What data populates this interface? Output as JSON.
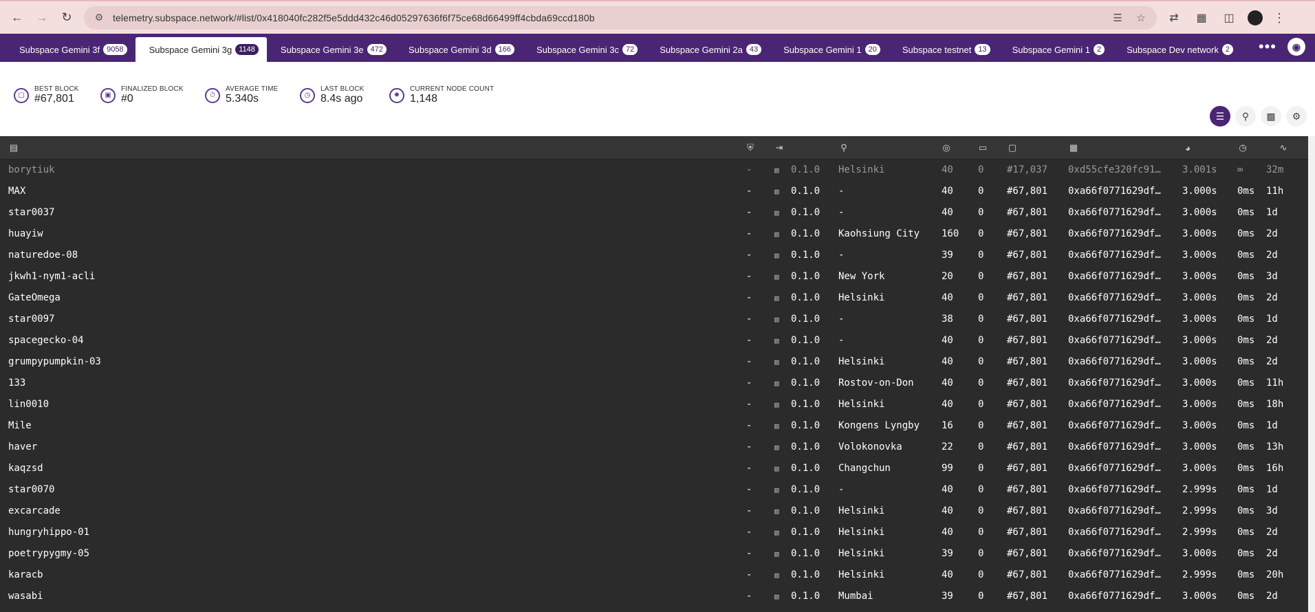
{
  "browser": {
    "url": "telemetry.subspace.network/#list/0x418040fc282f5e5ddd432c46d05297636f6f75ce68d66499ff4cbda69ccd180b"
  },
  "tabs": [
    {
      "label": "Subspace Gemini 3f",
      "count": "9058",
      "active": false
    },
    {
      "label": "Subspace Gemini 3g",
      "count": "1148",
      "active": true
    },
    {
      "label": "Subspace Gemini 3e",
      "count": "472",
      "active": false
    },
    {
      "label": "Subspace Gemini 3d",
      "count": "166",
      "active": false
    },
    {
      "label": "Subspace Gemini 3c",
      "count": "72",
      "active": false
    },
    {
      "label": "Subspace Gemini 2a",
      "count": "43",
      "active": false
    },
    {
      "label": "Subspace Gemini 1",
      "count": "20",
      "active": false
    },
    {
      "label": "Subspace testnet",
      "count": "13",
      "active": false
    },
    {
      "label": "Subspace Gemini 1",
      "count": "2",
      "active": false
    },
    {
      "label": "Subspace Dev network",
      "count": "2",
      "active": false
    }
  ],
  "stats": {
    "best_block": {
      "label": "Best Block",
      "value": "#67,801"
    },
    "finalized_block": {
      "label": "Finalized Block",
      "value": "#0"
    },
    "average_time": {
      "label": "Average Time",
      "value": "5.340s"
    },
    "last_block": {
      "label": "Last Block",
      "value": "8.4s ago"
    },
    "node_count": {
      "label": "Current Node Count",
      "value": "1,148"
    }
  },
  "nodes": [
    {
      "name": "borytiuk",
      "validator": "-",
      "version": "0.1.0",
      "location": "Helsinki",
      "peers": "40",
      "txs": "0",
      "block": "#17,037",
      "hash": "0xd55cfe320fc91…",
      "time": "3.001s",
      "propagation": "∞",
      "uptime": "32m",
      "stale": true
    },
    {
      "name": "MAX",
      "validator": "-",
      "version": "0.1.0",
      "location": "-",
      "peers": "40",
      "txs": "0",
      "block": "#67,801",
      "hash": "0xa66f0771629df…",
      "time": "3.000s",
      "propagation": "0ms",
      "uptime": "11h"
    },
    {
      "name": "star0037",
      "validator": "-",
      "version": "0.1.0",
      "location": "-",
      "peers": "40",
      "txs": "0",
      "block": "#67,801",
      "hash": "0xa66f0771629df…",
      "time": "3.000s",
      "propagation": "0ms",
      "uptime": "1d"
    },
    {
      "name": "huayiw",
      "validator": "-",
      "version": "0.1.0",
      "location": "Kaohsiung City",
      "peers": "160",
      "txs": "0",
      "block": "#67,801",
      "hash": "0xa66f0771629df…",
      "time": "3.000s",
      "propagation": "0ms",
      "uptime": "2d"
    },
    {
      "name": "naturedoe-08",
      "validator": "-",
      "version": "0.1.0",
      "location": "-",
      "peers": "39",
      "txs": "0",
      "block": "#67,801",
      "hash": "0xa66f0771629df…",
      "time": "3.000s",
      "propagation": "0ms",
      "uptime": "2d"
    },
    {
      "name": "jkwh1-nym1-acli",
      "validator": "-",
      "version": "0.1.0",
      "location": "New York",
      "peers": "20",
      "txs": "0",
      "block": "#67,801",
      "hash": "0xa66f0771629df…",
      "time": "3.000s",
      "propagation": "0ms",
      "uptime": "3d"
    },
    {
      "name": "GateOmega",
      "validator": "-",
      "version": "0.1.0",
      "location": "Helsinki",
      "peers": "40",
      "txs": "0",
      "block": "#67,801",
      "hash": "0xa66f0771629df…",
      "time": "3.000s",
      "propagation": "0ms",
      "uptime": "2d"
    },
    {
      "name": "star0097",
      "validator": "-",
      "version": "0.1.0",
      "location": "-",
      "peers": "38",
      "txs": "0",
      "block": "#67,801",
      "hash": "0xa66f0771629df…",
      "time": "3.000s",
      "propagation": "0ms",
      "uptime": "1d"
    },
    {
      "name": "spacegecko-04",
      "validator": "-",
      "version": "0.1.0",
      "location": "-",
      "peers": "40",
      "txs": "0",
      "block": "#67,801",
      "hash": "0xa66f0771629df…",
      "time": "3.000s",
      "propagation": "0ms",
      "uptime": "2d"
    },
    {
      "name": "grumpypumpkin-03",
      "validator": "-",
      "version": "0.1.0",
      "location": "Helsinki",
      "peers": "40",
      "txs": "0",
      "block": "#67,801",
      "hash": "0xa66f0771629df…",
      "time": "3.000s",
      "propagation": "0ms",
      "uptime": "2d"
    },
    {
      "name": "133",
      "validator": "-",
      "version": "0.1.0",
      "location": "Rostov-on-Don",
      "peers": "40",
      "txs": "0",
      "block": "#67,801",
      "hash": "0xa66f0771629df…",
      "time": "3.000s",
      "propagation": "0ms",
      "uptime": "11h"
    },
    {
      "name": "lin0010",
      "validator": "-",
      "version": "0.1.0",
      "location": "Helsinki",
      "peers": "40",
      "txs": "0",
      "block": "#67,801",
      "hash": "0xa66f0771629df…",
      "time": "3.000s",
      "propagation": "0ms",
      "uptime": "18h"
    },
    {
      "name": "Mile",
      "validator": "-",
      "version": "0.1.0",
      "location": "Kongens Lyngby",
      "peers": "16",
      "txs": "0",
      "block": "#67,801",
      "hash": "0xa66f0771629df…",
      "time": "3.000s",
      "propagation": "0ms",
      "uptime": "1d"
    },
    {
      "name": "haver",
      "validator": "-",
      "version": "0.1.0",
      "location": "Volokonovka",
      "peers": "22",
      "txs": "0",
      "block": "#67,801",
      "hash": "0xa66f0771629df…",
      "time": "3.000s",
      "propagation": "0ms",
      "uptime": "13h"
    },
    {
      "name": "kaqzsd",
      "validator": "-",
      "version": "0.1.0",
      "location": "Changchun",
      "peers": "99",
      "txs": "0",
      "block": "#67,801",
      "hash": "0xa66f0771629df…",
      "time": "3.000s",
      "propagation": "0ms",
      "uptime": "16h"
    },
    {
      "name": "star0070",
      "validator": "-",
      "version": "0.1.0",
      "location": "-",
      "peers": "40",
      "txs": "0",
      "block": "#67,801",
      "hash": "0xa66f0771629df…",
      "time": "2.999s",
      "propagation": "0ms",
      "uptime": "1d"
    },
    {
      "name": "excarcade",
      "validator": "-",
      "version": "0.1.0",
      "location": "Helsinki",
      "peers": "40",
      "txs": "0",
      "block": "#67,801",
      "hash": "0xa66f0771629df…",
      "time": "2.999s",
      "propagation": "0ms",
      "uptime": "3d"
    },
    {
      "name": "hungryhippo-01",
      "validator": "-",
      "version": "0.1.0",
      "location": "Helsinki",
      "peers": "40",
      "txs": "0",
      "block": "#67,801",
      "hash": "0xa66f0771629df…",
      "time": "2.999s",
      "propagation": "0ms",
      "uptime": "2d"
    },
    {
      "name": "poetrypygmy-05",
      "validator": "-",
      "version": "0.1.0",
      "location": "Helsinki",
      "peers": "39",
      "txs": "0",
      "block": "#67,801",
      "hash": "0xa66f0771629df…",
      "time": "3.000s",
      "propagation": "0ms",
      "uptime": "2d"
    },
    {
      "name": "karacb",
      "validator": "-",
      "version": "0.1.0",
      "location": "Helsinki",
      "peers": "40",
      "txs": "0",
      "block": "#67,801",
      "hash": "0xa66f0771629df…",
      "time": "2.999s",
      "propagation": "0ms",
      "uptime": "20h"
    },
    {
      "name": "wasabi",
      "validator": "-",
      "version": "0.1.0",
      "location": "Mumbai",
      "peers": "39",
      "txs": "0",
      "block": "#67,801",
      "hash": "0xa66f0771629df…",
      "time": "3.000s",
      "propagation": "0ms",
      "uptime": "2d"
    }
  ],
  "colors": {
    "brand": "#4a2574",
    "table_bg": "#2b2b2b",
    "chrome_bg": "#f4dfdf"
  }
}
